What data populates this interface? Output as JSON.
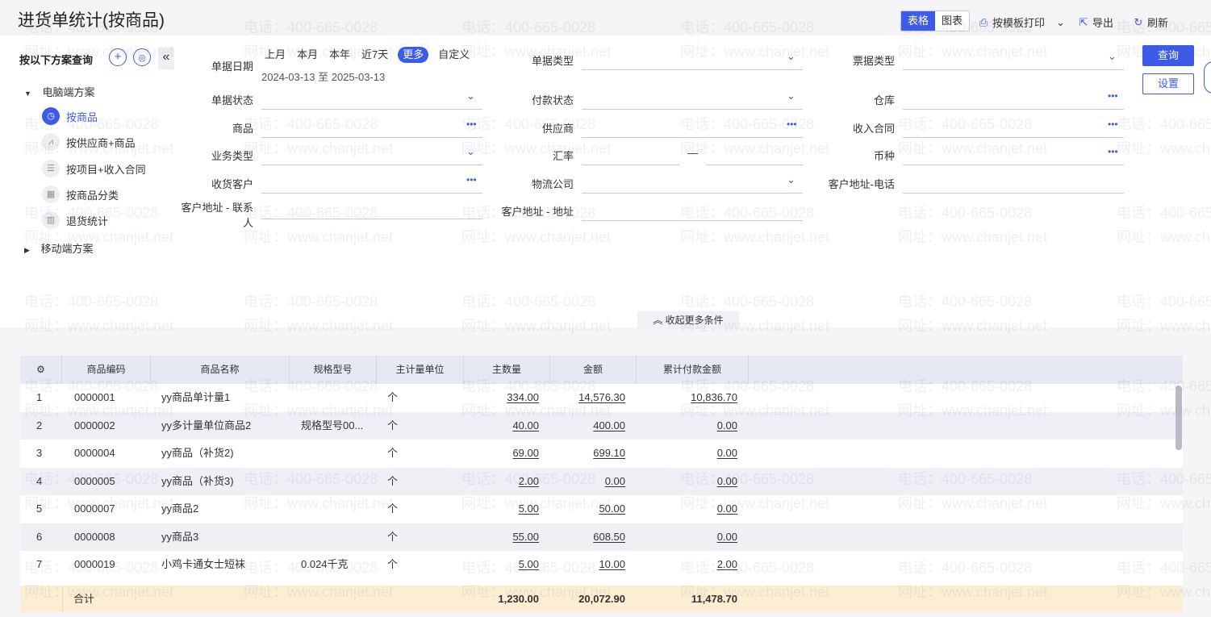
{
  "header": {
    "title": "进货单统计(按商品)",
    "view_table": "表格",
    "view_chart": "图表",
    "print_label": "按模板打印",
    "export_label": "导出",
    "refresh_label": "刷新"
  },
  "left": {
    "heading": "按以下方案查询",
    "pc_group": "电脑端方案",
    "items": [
      {
        "label": "按商品",
        "active": true
      },
      {
        "label": "按供应商+商品",
        "active": false
      },
      {
        "label": "按项目+收入合同",
        "active": false
      },
      {
        "label": "按商品分类",
        "active": false
      },
      {
        "label": "退货统计",
        "active": false
      }
    ],
    "mobile_group": "移动端方案"
  },
  "filters": {
    "date_label": "单据日期",
    "date_shortcuts": [
      "上月",
      "本月",
      "本年",
      "近7天",
      "更多",
      "自定义"
    ],
    "date_active": "更多",
    "date_range": "2024-03-13 至 2025-03-13",
    "doc_type": "单据类型",
    "invoice_type": "票据类型",
    "doc_status": "单据状态",
    "pay_status": "付款状态",
    "warehouse": "仓库",
    "product": "商品",
    "supplier": "供应商",
    "income_contract": "收入合同",
    "biz_type": "业务类型",
    "exchange_rate": "汇率",
    "rate_separator": "—",
    "currency": "币种",
    "receiver": "收货客户",
    "logistics": "物流公司",
    "addr_phone": "客户地址-电话",
    "addr_contact_1": "客户地址 - 联系",
    "addr_contact_2": "人",
    "addr_address": "客户地址 - 地址",
    "collapse_more": "收起更多条件"
  },
  "buttons": {
    "query": "查询",
    "settings": "设置"
  },
  "table": {
    "columns": [
      "商品编码",
      "商品名称",
      "规格型号",
      "主计量单位",
      "主数量",
      "金额",
      "累计付款金额"
    ],
    "rows": [
      {
        "idx": "1",
        "code": "0000001",
        "name": "yy商品单计量1",
        "spec": "",
        "unit": "个",
        "qty": "334.00",
        "amount": "14,576.30",
        "paid": "10,836.70"
      },
      {
        "idx": "2",
        "code": "0000002",
        "name": "yy多计量单位商品2",
        "spec": "规格型号00...",
        "unit": "个",
        "qty": "40.00",
        "amount": "400.00",
        "paid": "0.00"
      },
      {
        "idx": "3",
        "code": "0000004",
        "name": "yy商品（补货2)",
        "spec": "",
        "unit": "个",
        "qty": "69.00",
        "amount": "699.10",
        "paid": "0.00"
      },
      {
        "idx": "4",
        "code": "0000005",
        "name": "yy商品（补货3)",
        "spec": "",
        "unit": "个",
        "qty": "2.00",
        "amount": "0.00",
        "paid": "0.00"
      },
      {
        "idx": "5",
        "code": "0000007",
        "name": "yy商品2",
        "spec": "",
        "unit": "个",
        "qty": "5.00",
        "amount": "50.00",
        "paid": "0.00"
      },
      {
        "idx": "6",
        "code": "0000008",
        "name": "yy商品3",
        "spec": "",
        "unit": "个",
        "qty": "55.00",
        "amount": "608.50",
        "paid": "0.00"
      },
      {
        "idx": "7",
        "code": "0000019",
        "name": "小鸡卡通女士短袜",
        "spec": "0.024千克",
        "unit": "个",
        "qty": "5.00",
        "amount": "10.00",
        "paid": "2.00"
      }
    ],
    "total": {
      "label": "合计",
      "qty": "1,230.00",
      "amount": "20,072.90",
      "paid": "11,478.70"
    }
  },
  "watermark": {
    "phone": "电话：400-665-0028",
    "site": "网址：www.chanjet.net"
  },
  "colors": {
    "accent": "#3b5be8",
    "header_bg": "#e6e8f3",
    "total_bg": "#fbeed3"
  }
}
